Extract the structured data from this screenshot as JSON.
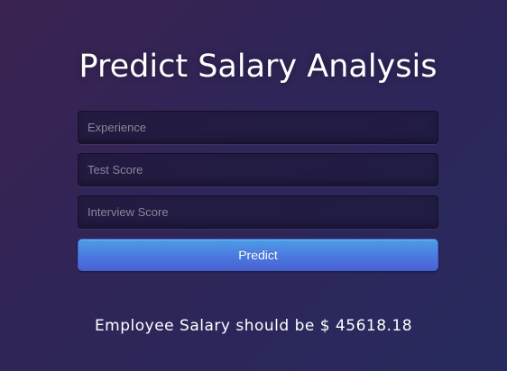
{
  "page": {
    "title": "Predict Salary Analysis"
  },
  "form": {
    "experience_placeholder": "Experience",
    "experience_value": "",
    "test_score_placeholder": "Test Score",
    "test_score_value": "",
    "interview_score_placeholder": "Interview Score",
    "interview_score_value": "",
    "predict_label": "Predict"
  },
  "result": {
    "text": "Employee Salary should be $ 45618.18"
  },
  "colors": {
    "background_start": "#3a2350",
    "background_end": "#272a5e",
    "button": "#4a79e0",
    "text": "#ffffff"
  }
}
